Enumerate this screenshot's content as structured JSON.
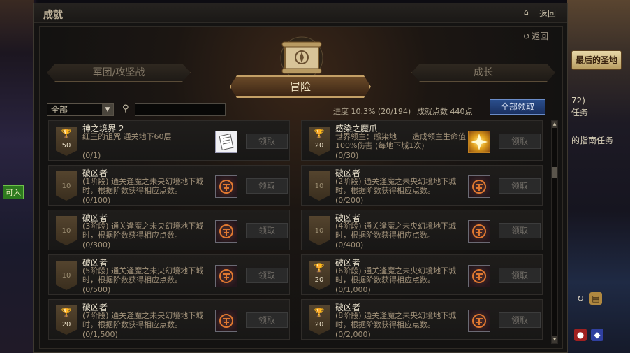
{
  "window": {
    "title": "成就",
    "back_label": "返回"
  },
  "sub": {
    "back_label": "返回"
  },
  "tabs": [
    {
      "label": "军团/攻坚战",
      "active": false
    },
    {
      "label": "冒险",
      "active": true
    },
    {
      "label": "成长",
      "active": false
    }
  ],
  "filter": {
    "selected": "全部"
  },
  "stats": {
    "progress": "进度 10.3% (20/194)",
    "points": "成就点数 440点"
  },
  "claim_all_label": "全部领取",
  "cards": [
    {
      "name": "神之境界 2",
      "desc": "红王的诅咒 通关地下60层",
      "count": "(0/1)",
      "points": "50",
      "badge": "gold",
      "reward": "document",
      "claim": "领取"
    },
    {
      "name": "感染之魔爪",
      "desc": "世界领主：感染地　　造成领主生命值100%伤害 (每地下城1次)",
      "count": "(0/30)",
      "points": "20",
      "badge": "silver",
      "reward": "gold-star",
      "claim": "领取"
    },
    {
      "name": "破凶者",
      "desc": "(1阶段) 通关逢魔之未央幻境地下城时，根据阶数获得相应点数。",
      "count": "(0/100)",
      "points": "10",
      "badge": "plain",
      "reward": "emblem",
      "claim": "领取"
    },
    {
      "name": "破凶者",
      "desc": "(2阶段) 通关逢魔之未央幻境地下城时，根据阶数获得相应点数。",
      "count": "(0/200)",
      "points": "10",
      "badge": "plain",
      "reward": "emblem",
      "claim": "领取"
    },
    {
      "name": "破凶者",
      "desc": "(3阶段) 通关逢魔之未央幻境地下城时，根据阶数获得相应点数。",
      "count": "(0/300)",
      "points": "10",
      "badge": "plain",
      "reward": "emblem",
      "claim": "领取"
    },
    {
      "name": "破凶者",
      "desc": "(4阶段) 通关逢魔之未央幻境地下城时，根据阶数获得相应点数。",
      "count": "(0/400)",
      "points": "10",
      "badge": "plain",
      "reward": "emblem",
      "claim": "领取"
    },
    {
      "name": "破凶者",
      "desc": "(5阶段) 通关逢魔之未央幻境地下城时，根据阶数获得相应点数。",
      "count": "(0/500)",
      "points": "10",
      "badge": "plain",
      "reward": "emblem",
      "claim": "领取"
    },
    {
      "name": "破凶者",
      "desc": "(6阶段) 通关逢魔之未央幻境地下城时，根据阶数获得相应点数。",
      "count": "(0/1,000)",
      "points": "20",
      "badge": "silver",
      "reward": "emblem",
      "claim": "领取"
    },
    {
      "name": "破凶者",
      "desc": "(7阶段) 通关逢魔之未央幻境地下城时，根据阶数获得相应点数。",
      "count": "(0/1,500)",
      "points": "20",
      "badge": "silver",
      "reward": "emblem",
      "claim": "领取"
    },
    {
      "name": "破凶者",
      "desc": "(8阶段) 通关逢魔之未央幻境地下城时，根据阶数获得相应点数。",
      "count": "(0/2,000)",
      "points": "20",
      "badge": "silver",
      "reward": "emblem",
      "claim": "领取"
    }
  ],
  "background": {
    "left_tag": "可入",
    "right_button": "最后的圣地",
    "right_texts": [
      "72)",
      "任务",
      "的指南任务"
    ]
  },
  "colors": {
    "accent_gold": "#c4a066",
    "claim_all_blue": "#2a4e8c"
  }
}
